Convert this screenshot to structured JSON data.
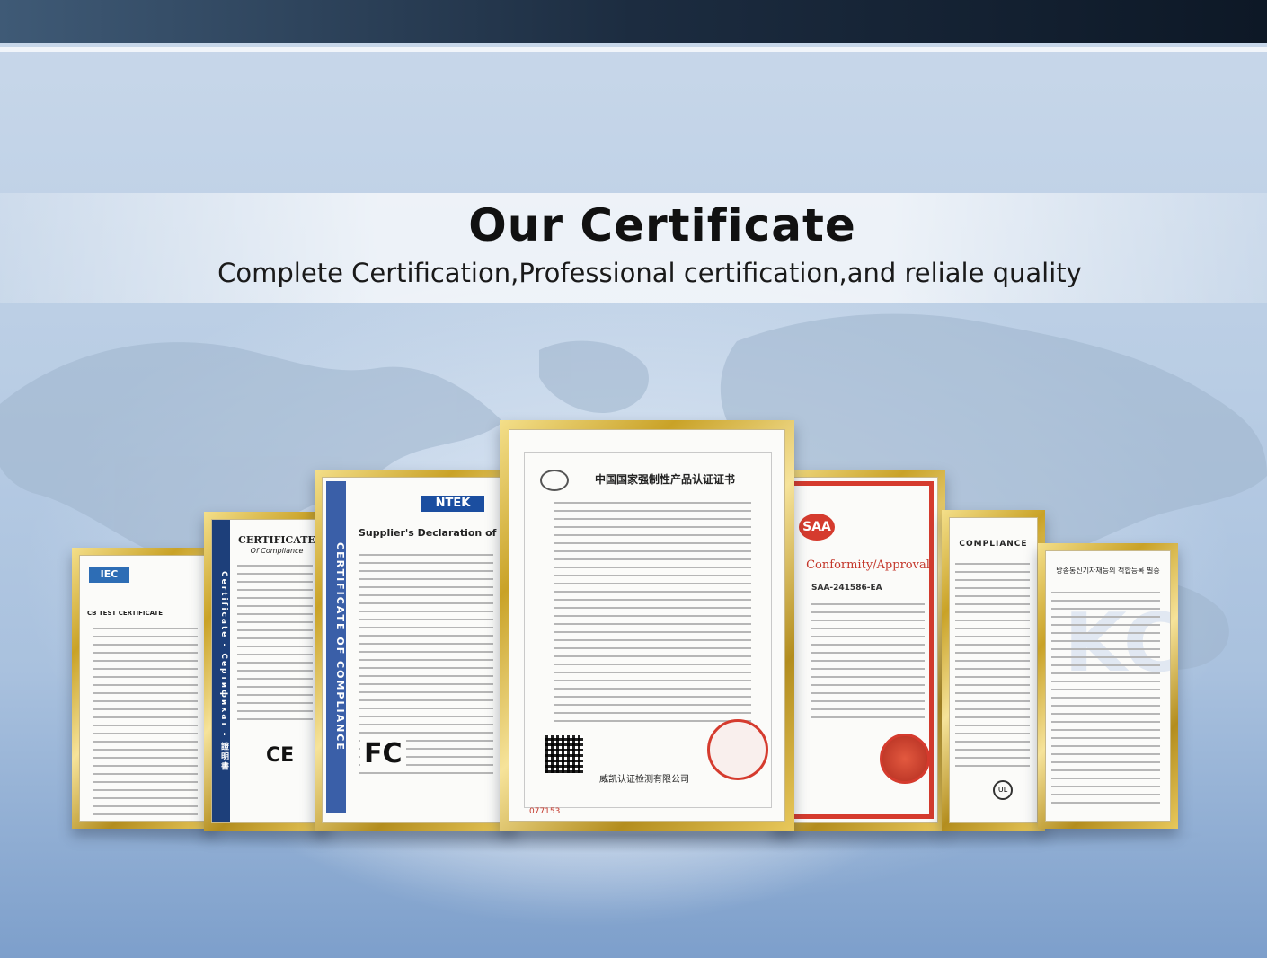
{
  "header": {
    "title": "Our Certificate",
    "subtitle": "Complete Certification,Professional certification,and reliale quality"
  },
  "certificates": [
    {
      "id": "iecee",
      "heading": "CB TEST CERTIFICATE",
      "mark": "IEC"
    },
    {
      "id": "ce",
      "heading": "CERTIFICATE",
      "sub": "Of Compliance",
      "mark": "CE",
      "band": "Certificate - Сертификат - 證明書"
    },
    {
      "id": "fcc",
      "heading": "Supplier's Declaration of Conformity",
      "logo": "NTEK",
      "band": "CERTIFICATE OF COMPLIANCE",
      "mark": "FC"
    },
    {
      "id": "ccc",
      "heading": "中国国家强制性产品认证证书",
      "footer": "威凯认证检测有限公司",
      "serial": "077153"
    },
    {
      "id": "saa",
      "heading": "Conformity/Approval",
      "logo": "SAA",
      "number": "SAA-241586-EA"
    },
    {
      "id": "ul",
      "heading": "COMPLIANCE",
      "mark": "UL"
    },
    {
      "id": "kc",
      "heading": "방송통신기자재등의 적합등록 필증",
      "mark": "KC"
    }
  ],
  "colors": {
    "frame_gold": "#c9a227",
    "title_text": "#111111",
    "topbar": "#1c2c40",
    "saa_red": "#d53b2e",
    "fcc_blue": "#1b4ea0"
  }
}
